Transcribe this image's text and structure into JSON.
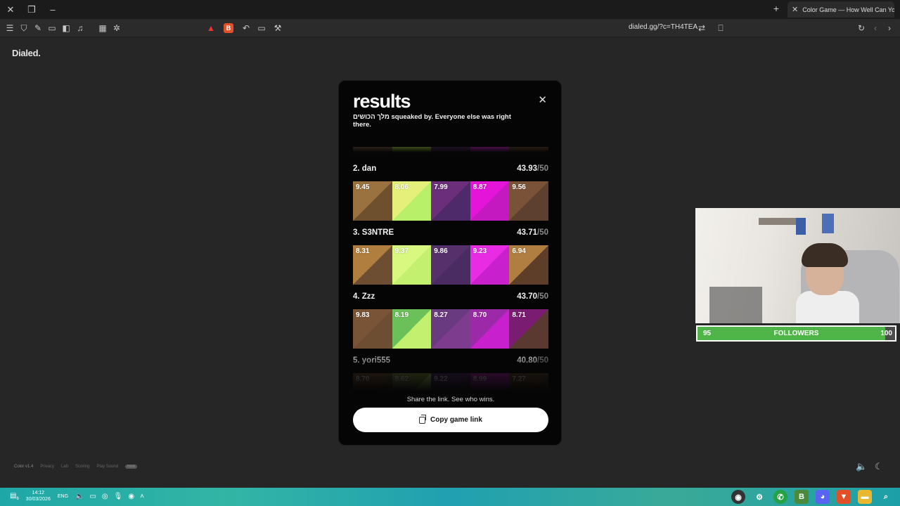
{
  "browser": {
    "tab_title": "Color Game — How Well Can Yo",
    "url": "dialed.gg/?c=TH4TEA"
  },
  "page": {
    "logo": "Dialed."
  },
  "modal": {
    "title": "results",
    "subtitle": "מלך הכושים squeaked by. Everyone else was right there.",
    "share_text": "Share the link. See who wins.",
    "copy_label": "Copy game link",
    "entries": [
      {
        "rank_name": "2. dan",
        "score": "43.93",
        "max": "/50",
        "swatches": [
          {
            "value": "9.45",
            "target": "#9a7240",
            "guess": "#6e4f2e"
          },
          {
            "value": "8.06",
            "target": "#e4f07a",
            "guess": "#b8f06a"
          },
          {
            "value": "7.99",
            "target": "#6a2e7a",
            "guess": "#4e2a6a"
          },
          {
            "value": "8.87",
            "target": "#e414d8",
            "guess": "#c418c0"
          },
          {
            "value": "9.56",
            "target": "#7a5238",
            "guess": "#5e4030"
          }
        ]
      },
      {
        "rank_name": "3. S3NTRE",
        "score": "43.71",
        "max": "/50",
        "swatches": [
          {
            "value": "8.31",
            "target": "#b07e3e",
            "guess": "#6e4e32"
          },
          {
            "value": "9.37",
            "target": "#d8f880",
            "guess": "#c4f070"
          },
          {
            "value": "9.86",
            "target": "#55306a",
            "guess": "#4a2c62"
          },
          {
            "value": "9.23",
            "target": "#e82ce4",
            "guess": "#c820cc"
          },
          {
            "value": "6.94",
            "target": "#b07e40",
            "guess": "#5e3e28"
          }
        ]
      },
      {
        "rank_name": "4. Zzz",
        "score": "43.70",
        "max": "/50",
        "swatches": [
          {
            "value": "9.83",
            "target": "#7a5436",
            "guess": "#6e4e32"
          },
          {
            "value": "8.19",
            "target": "#6cc05a",
            "guess": "#c4f070"
          },
          {
            "value": "8.27",
            "target": "#6a3a80",
            "guess": "#7e3c8e"
          },
          {
            "value": "8.70",
            "target": "#9c2aa8",
            "guess": "#c820cc"
          },
          {
            "value": "8.71",
            "target": "#7a1c72",
            "guess": "#5a3a30"
          }
        ]
      },
      {
        "rank_name": "5. yori555",
        "score": "40.80",
        "max": "/50",
        "swatches": [
          {
            "value": "8.70",
            "target": "#7a5436",
            "guess": "#6e4e32"
          },
          {
            "value": "8.62",
            "target": "#8aa040",
            "guess": "#c4f070"
          },
          {
            "value": "9.22",
            "target": "#5a3070",
            "guess": "#4a2c62"
          },
          {
            "value": "8.99",
            "target": "#c020c0",
            "guess": "#c820cc"
          },
          {
            "value": "7.27",
            "target": "#6a4a30",
            "guess": "#5e3e28"
          }
        ]
      }
    ]
  },
  "footer": {
    "links": [
      "Color v1.4",
      "Privacy",
      "Lab",
      "Scoring",
      "Play Sound"
    ],
    "pill": "new"
  },
  "overlay": {
    "followers_label": "FOLLOWERS",
    "followers_current": "95",
    "followers_goal": "100",
    "followers_progress": 0.95
  },
  "taskbar": {
    "time": "14:12",
    "date": "30/03/2026",
    "lang": "ENG",
    "notif": "6"
  }
}
